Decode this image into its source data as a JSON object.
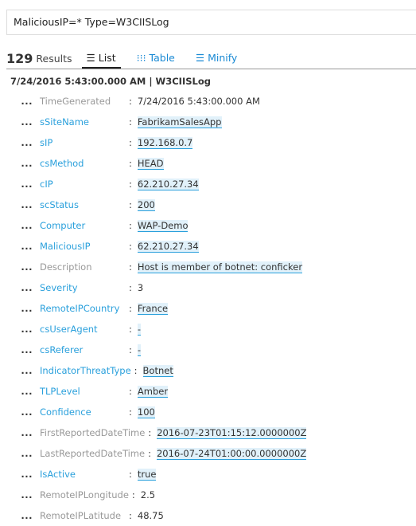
{
  "search": {
    "query": "MaliciousIP=* Type=W3CIISLog"
  },
  "results": {
    "count": "129",
    "label": "Results"
  },
  "tabs": [
    {
      "label": "List",
      "icon": "list-icon",
      "active": true
    },
    {
      "label": "Table",
      "icon": "table-grid-icon",
      "active": false
    },
    {
      "label": "Minify",
      "icon": "minify-icon",
      "active": false
    }
  ],
  "record": {
    "header": "7/24/2016 5:43:00.000 AM | W3CIISLog",
    "more_glyph": "...",
    "fields": [
      {
        "name": "TimeGenerated",
        "value": "7/24/2016 5:43:00.000 AM",
        "name_style": "gray",
        "highlight": false
      },
      {
        "name": "sSiteName",
        "value": "FabrikamSalesApp",
        "name_style": "link",
        "highlight": true
      },
      {
        "name": "sIP",
        "value": "192.168.0.7",
        "name_style": "link",
        "highlight": true
      },
      {
        "name": "csMethod",
        "value": "HEAD",
        "name_style": "link",
        "highlight": true
      },
      {
        "name": "cIP",
        "value": "62.210.27.34",
        "name_style": "link",
        "highlight": true
      },
      {
        "name": "scStatus",
        "value": "200",
        "name_style": "link",
        "highlight": true
      },
      {
        "name": "Computer",
        "value": "WAP-Demo",
        "name_style": "link",
        "highlight": true
      },
      {
        "name": "MaliciousIP",
        "value": "62.210.27.34",
        "name_style": "link",
        "highlight": true
      },
      {
        "name": "Description",
        "value": "Host is member of botnet: conficker",
        "name_style": "gray",
        "highlight": true
      },
      {
        "name": "Severity",
        "value": "3",
        "name_style": "link",
        "highlight": false
      },
      {
        "name": "RemoteIPCountry",
        "value": "France",
        "name_style": "link",
        "highlight": true
      },
      {
        "name": "csUserAgent",
        "value": "-",
        "name_style": "link",
        "highlight": true
      },
      {
        "name": "csReferer",
        "value": "-",
        "name_style": "link",
        "highlight": true
      },
      {
        "name": "IndicatorThreatType",
        "value": "Botnet",
        "name_style": "link",
        "highlight": true
      },
      {
        "name": "TLPLevel",
        "value": "Amber",
        "name_style": "link",
        "highlight": true
      },
      {
        "name": "Confidence",
        "value": "100",
        "name_style": "link",
        "highlight": true
      },
      {
        "name": "FirstReportedDateTime",
        "value": "2016-07-23T01:15:12.0000000Z",
        "name_style": "gray",
        "highlight": true
      },
      {
        "name": "LastReportedDateTime",
        "value": "2016-07-24T01:00:00.0000000Z",
        "name_style": "gray",
        "highlight": true
      },
      {
        "name": "IsActive",
        "value": "true",
        "name_style": "link",
        "highlight": true
      },
      {
        "name": "RemoteIPLongitude",
        "value": "2.5",
        "name_style": "gray",
        "highlight": false
      },
      {
        "name": "RemoteIPLatitude",
        "value": "48.75",
        "name_style": "gray",
        "highlight": false
      }
    ]
  }
}
